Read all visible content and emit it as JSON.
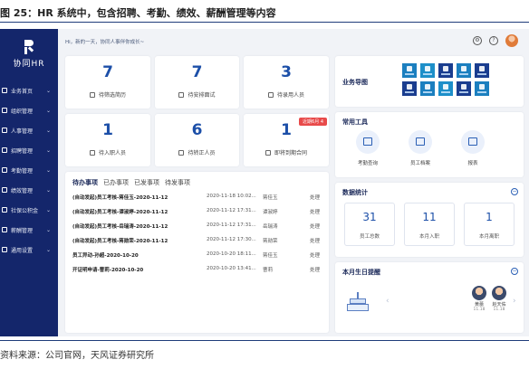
{
  "figure": {
    "caption": "图 25：HR 系统中，包含招聘、考勤、绩效、薪酬管理等内容",
    "source": "资料来源：公司官网，天风证券研究所"
  },
  "app": {
    "logo_text": "协同HR",
    "greeting": "Hi，新的一天，协同人事伴你成长~"
  },
  "sidebar": {
    "items": [
      {
        "label": "业务首页"
      },
      {
        "label": "组织管理"
      },
      {
        "label": "人事管理"
      },
      {
        "label": "招聘管理"
      },
      {
        "label": "考勤管理"
      },
      {
        "label": "绩效管理"
      },
      {
        "label": "社保公积金"
      },
      {
        "label": "薪酬管理"
      },
      {
        "label": "通用设置"
      }
    ]
  },
  "stats": [
    {
      "value": "7",
      "label": "待筛选简历"
    },
    {
      "value": "7",
      "label": "待安排面试"
    },
    {
      "value": "3",
      "label": "待录用人员"
    },
    {
      "value": "1",
      "label": "待入职人员"
    },
    {
      "value": "6",
      "label": "待转正人员"
    },
    {
      "value": "1",
      "label": "即将到期合同",
      "badge": "近期6月 4"
    }
  ],
  "tasks": {
    "tabs": [
      "待办事项",
      "已办事项",
      "已发事项",
      "待发事项"
    ],
    "rows": [
      {
        "title": "(自动发起)员工考核-蒋佳玉-2020-11-12",
        "time": "2020-11-18 10:02...",
        "person": "蒋佳玉",
        "action": "处理"
      },
      {
        "title": "(自动发起)员工考核-谭淑婷-2020-11-12",
        "time": "2020-11-12 17:31...",
        "person": "谭淑婷",
        "action": "处理"
      },
      {
        "title": "(自动发起)员工考核-岳瑞涛-2020-11-12",
        "time": "2020-11-12 17:31...",
        "person": "岳瑞涛",
        "action": "处理"
      },
      {
        "title": "(自动发起)员工考核-蒋勋荣-2020-11-12",
        "time": "2020-11-12 17:30...",
        "person": "蒋勋荣",
        "action": "处理"
      },
      {
        "title": "员工异动-孙超-2020-10-20",
        "time": "2020-10-20 18:11...",
        "person": "蒋佳玉",
        "action": "处理"
      },
      {
        "title": "开证明申请-曹莉-2020-10-20",
        "time": "2020-10-20 13:41...",
        "person": "曹莉",
        "action": "处理"
      }
    ]
  },
  "business_map": {
    "title": "业务导图"
  },
  "tools": {
    "title": "常用工具",
    "items": [
      {
        "label": "考勤查询"
      },
      {
        "label": "员工档案"
      },
      {
        "label": "报表"
      }
    ]
  },
  "data_stats": {
    "title": "数据统计",
    "items": [
      {
        "value": "31",
        "label": "员工总数"
      },
      {
        "value": "11",
        "label": "本月入职"
      },
      {
        "value": "1",
        "label": "本月离职"
      }
    ]
  },
  "birthday": {
    "title": "本月生日提醒",
    "people": [
      {
        "name": "黄蕾",
        "date": "11.18"
      },
      {
        "name": "赵天佑",
        "date": "11.18"
      }
    ]
  }
}
